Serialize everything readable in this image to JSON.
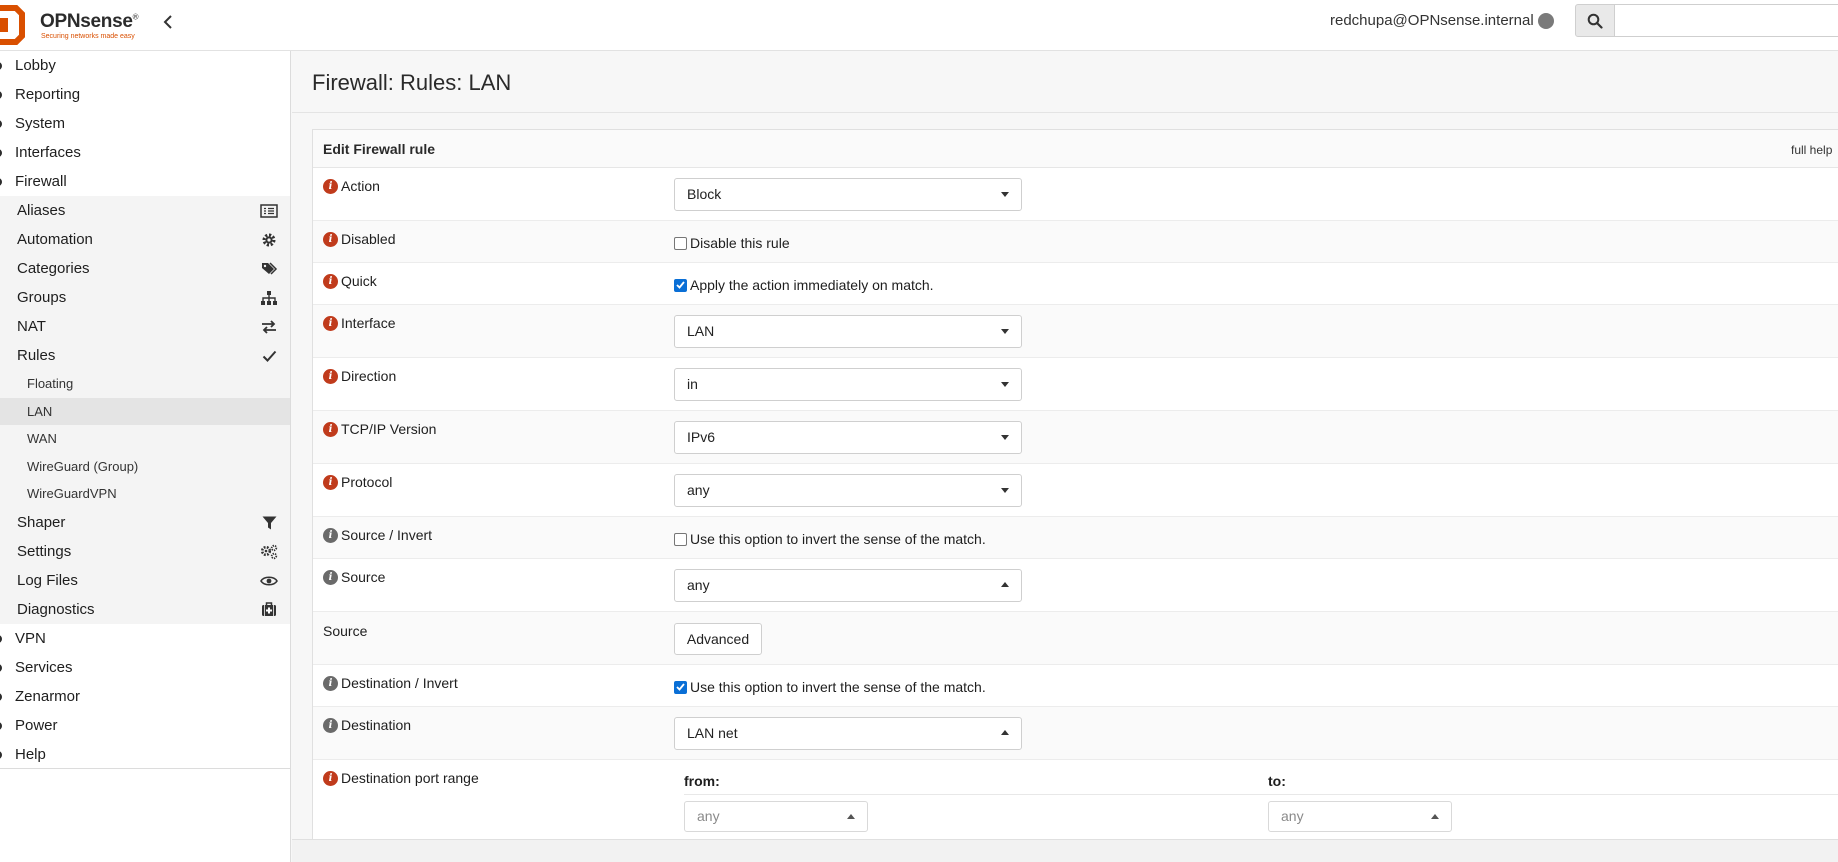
{
  "header": {
    "logo_text": "OPNsense",
    "logo_reg": "®",
    "logo_tagline": "Securing networks made easy",
    "user": "redchupa@OPNsense.internal",
    "search_placeholder": ""
  },
  "sidebar": {
    "top_items": [
      {
        "label": "Lobby"
      },
      {
        "label": "Reporting"
      },
      {
        "label": "System"
      },
      {
        "label": "Interfaces"
      },
      {
        "label": "Firewall"
      }
    ],
    "firewall_items": [
      {
        "label": "Aliases",
        "icon": "list-icon"
      },
      {
        "label": "Automation",
        "icon": "gear-icon"
      },
      {
        "label": "Categories",
        "icon": "tags-icon"
      },
      {
        "label": "Groups",
        "icon": "sitemap-icon"
      },
      {
        "label": "NAT",
        "icon": "exchange-icon"
      },
      {
        "label": "Rules",
        "icon": "check-icon"
      }
    ],
    "rules_items": [
      {
        "label": "Floating"
      },
      {
        "label": "LAN"
      },
      {
        "label": "WAN"
      },
      {
        "label": "WireGuard (Group)"
      },
      {
        "label": "WireGuardVPN"
      }
    ],
    "firewall_items_after": [
      {
        "label": "Shaper",
        "icon": "filter-icon"
      },
      {
        "label": "Settings",
        "icon": "cogs-icon"
      },
      {
        "label": "Log Files",
        "icon": "eye-icon"
      },
      {
        "label": "Diagnostics",
        "icon": "medkit-icon"
      }
    ],
    "bottom_items": [
      {
        "label": "VPN"
      },
      {
        "label": "Services"
      },
      {
        "label": "Zenarmor"
      },
      {
        "label": "Power"
      },
      {
        "label": "Help"
      }
    ]
  },
  "page": {
    "title": "Firewall: Rules: LAN",
    "panel_title": "Edit Firewall rule",
    "full_help": "full help"
  },
  "form": {
    "action": {
      "label": "Action",
      "value": "Block"
    },
    "disabled": {
      "label": "Disabled",
      "checkbox_label": "Disable this rule",
      "checked": false
    },
    "quick": {
      "label": "Quick",
      "checkbox_label": "Apply the action immediately on match.",
      "checked": true
    },
    "interface": {
      "label": "Interface",
      "value": "LAN"
    },
    "direction": {
      "label": "Direction",
      "value": "in"
    },
    "ipversion": {
      "label": "TCP/IP Version",
      "value": "IPv6"
    },
    "protocol": {
      "label": "Protocol",
      "value": "any"
    },
    "source_invert": {
      "label": "Source / Invert",
      "checkbox_label": "Use this option to invert the sense of the match.",
      "checked": false
    },
    "source": {
      "label": "Source",
      "value": "any"
    },
    "source_adv": {
      "label": "Source",
      "button": "Advanced"
    },
    "dest_invert": {
      "label": "Destination / Invert",
      "checkbox_label": "Use this option to invert the sense of the match.",
      "checked": true
    },
    "destination": {
      "label": "Destination",
      "value": "LAN net"
    },
    "dest_port": {
      "label": "Destination port range",
      "from_label": "from:",
      "to_label": "to:",
      "from_value": "any",
      "to_value": "any"
    }
  },
  "colors": {
    "brand": "#d94f00",
    "info_required": "#c03b1c",
    "info_optional": "#6a6a6a",
    "checkbox_on": "#0a6fd6"
  }
}
